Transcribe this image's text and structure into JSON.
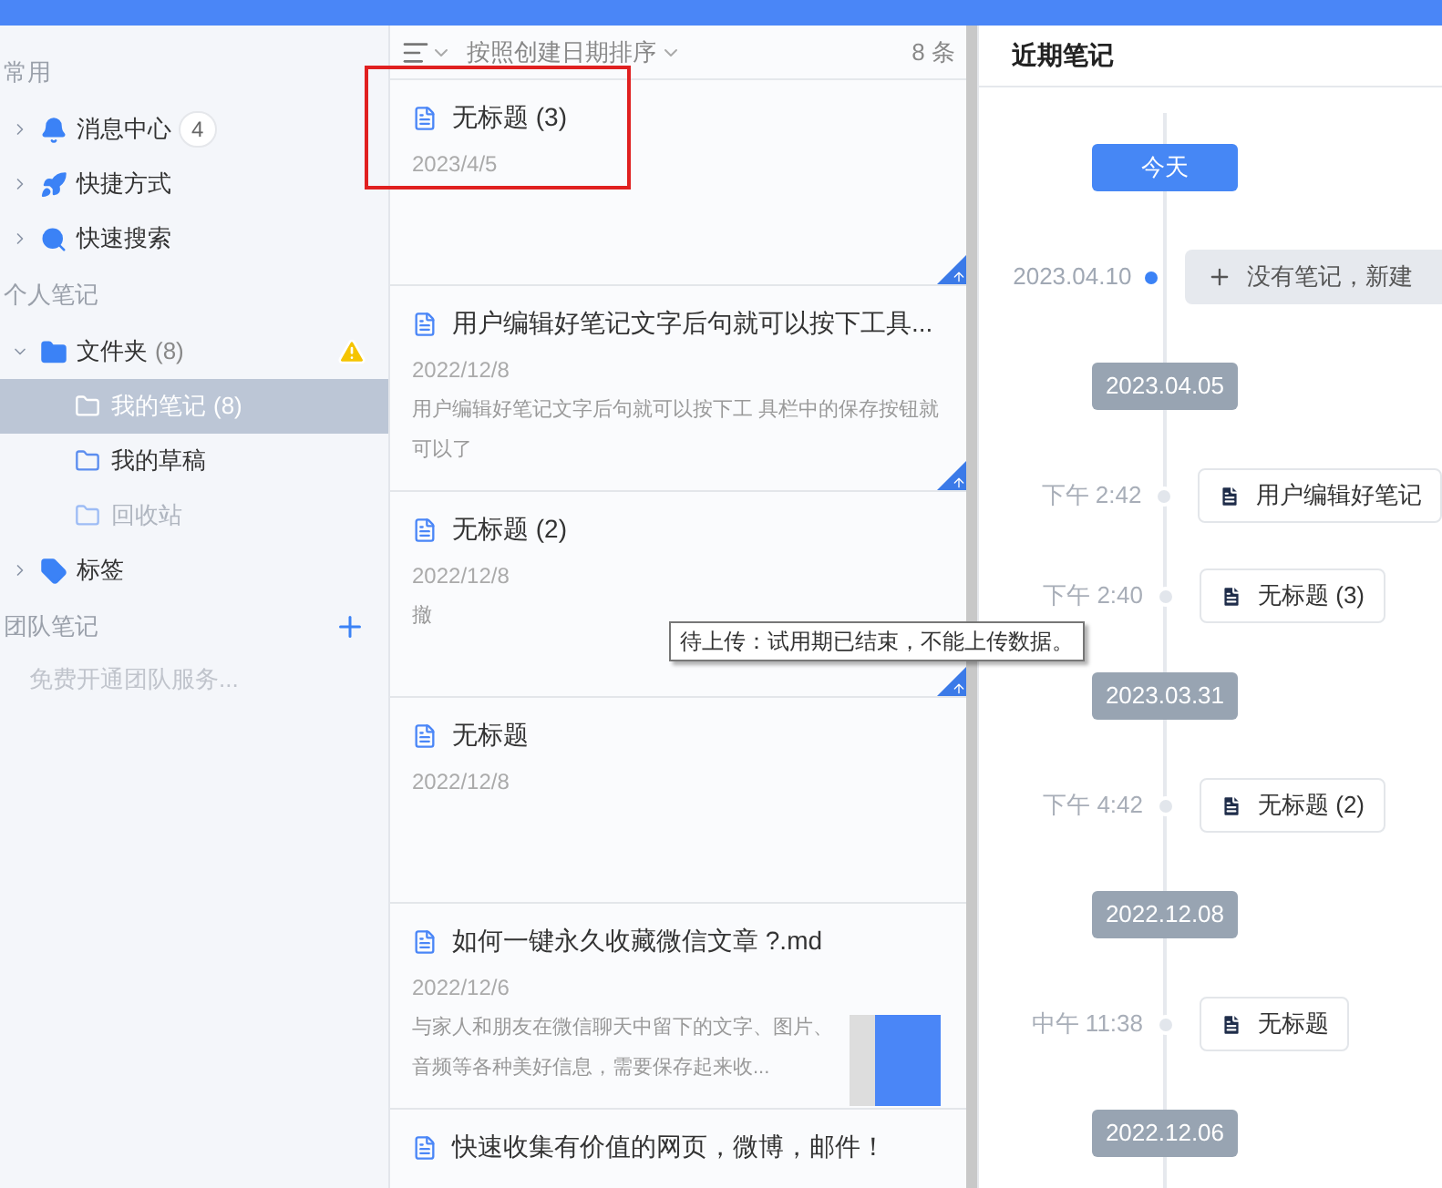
{
  "sidebar": {
    "sections": [
      {
        "title": "常用",
        "items": [
          {
            "kind": "bell",
            "label": "消息中心",
            "count": "4",
            "expanded": false,
            "selected": false,
            "warning": false
          },
          {
            "kind": "rocket",
            "label": "快捷方式",
            "expanded": false,
            "selected": false,
            "warning": false
          },
          {
            "kind": "search",
            "label": "快速搜索",
            "expanded": false,
            "selected": false,
            "warning": false
          }
        ]
      },
      {
        "title": "个人笔记",
        "items": [
          {
            "kind": "folder",
            "label": "文件夹",
            "count": "(8)",
            "expanded": true,
            "selected": false,
            "warning": true,
            "children": [
              {
                "kind": "subfolder",
                "label": "我的笔记",
                "count": "(8)",
                "selected": true,
                "disabled": false
              },
              {
                "kind": "subfolder",
                "label": "我的草稿",
                "selected": false,
                "disabled": false
              },
              {
                "kind": "subfolder",
                "label": "回收站",
                "selected": false,
                "disabled": true
              }
            ]
          },
          {
            "kind": "tag",
            "label": "标签",
            "expanded": false,
            "selected": false,
            "warning": false
          }
        ]
      },
      {
        "title": "团队笔记",
        "add": true,
        "hint": "免费开通团队服务..."
      }
    ]
  },
  "list": {
    "sort": "按照创建日期排序",
    "total": "8 条",
    "notes": [
      {
        "title": "无标题 (3)",
        "date": "2023/4/5",
        "pending_upload": true,
        "highlighted": true,
        "has_image": false
      },
      {
        "title": "用户编辑好笔记文字后句就可以按下工具...",
        "date": "2022/12/8",
        "snippet": "用户编辑好笔记文字后句就可以按下工 具栏中的保存按钮就可以了",
        "pending_upload": true,
        "has_image": false
      },
      {
        "title": "无标题 (2)",
        "date": "2022/12/8",
        "snippet": "撤",
        "pending_upload": true,
        "has_image": false
      },
      {
        "title": "无标题",
        "date": "2022/12/8",
        "pending_upload": false,
        "has_image": false
      },
      {
        "title": "如何一键永久收藏微信文章 ?.md",
        "date": "2022/12/6",
        "snippet": " 与家人和朋友在微信聊天中留下的文字、图片、音频等各种美好信息，需要保存起来收...",
        "pending_upload": false,
        "has_image": true
      },
      {
        "title": "快速收集有价值的网页，微博，邮件！",
        "has_image": false
      }
    ]
  },
  "tooltip": "待上传：试用期已结束，不能上传数据。",
  "recent": {
    "title": "近期笔记",
    "timeline": [
      {
        "kind": "chip",
        "text": "今天",
        "selected": true
      },
      {
        "kind": "new",
        "time": "2023.04.10",
        "text": "没有笔记，新建"
      },
      {
        "kind": "chip",
        "text": "2023.04.05",
        "selected": false
      },
      {
        "kind": "note",
        "time": "下午 2:42",
        "text": "用户编辑好笔记"
      },
      {
        "kind": "note",
        "time": "下午 2:40",
        "text": "无标题 (3)"
      },
      {
        "kind": "chip",
        "text": "2023.03.31",
        "selected": false
      },
      {
        "kind": "note",
        "time": "下午 4:42",
        "text": "无标题 (2)"
      },
      {
        "kind": "chip",
        "text": "2022.12.08",
        "selected": false
      },
      {
        "kind": "note",
        "time": "中午 11:38",
        "text": "无标题"
      },
      {
        "kind": "chip",
        "text": "2022.12.06",
        "selected": false
      }
    ]
  }
}
